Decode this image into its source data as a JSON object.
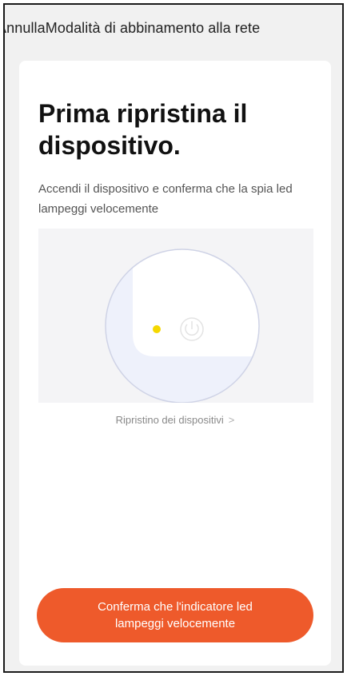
{
  "topbar": {
    "cancel_label": "Annulla",
    "title": "Modalità di abbinamento alla rete"
  },
  "card": {
    "heading": "Prima ripristina il dispositivo.",
    "description": "Accendi il dispositivo e conferma che la spia led lampeggi velocemente",
    "illustration": {
      "led_color": "#f5d800",
      "icon": "power-icon"
    },
    "reset_link": {
      "label": "Ripristino dei dispositivi",
      "chevron": ">"
    },
    "confirm_button": {
      "label": "Conferma che l'indicatore led lampeggi velocemente"
    }
  },
  "colors": {
    "accent": "#ee5a2b",
    "background": "#f1f1f1",
    "card": "#ffffff"
  }
}
